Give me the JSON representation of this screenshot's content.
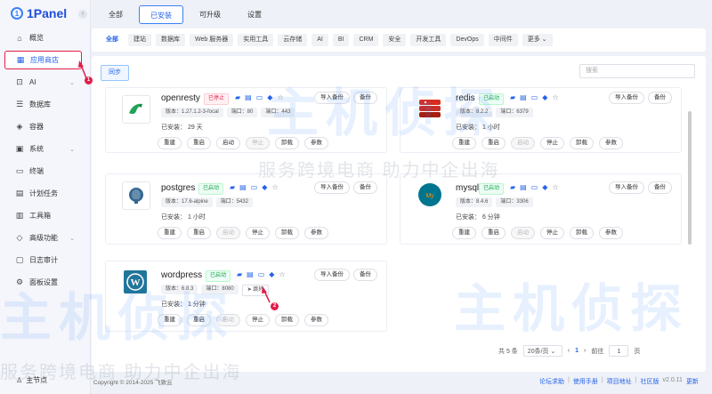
{
  "logo": {
    "text": "1Panel",
    "mark": "1"
  },
  "sidebar": {
    "items": [
      {
        "label": "概览",
        "icon": "home-icon"
      },
      {
        "label": "应用商店",
        "icon": "grid-icon",
        "active": true
      },
      {
        "label": "AI",
        "icon": "robot-icon",
        "expandable": true
      },
      {
        "label": "数据库",
        "icon": "database-icon"
      },
      {
        "label": "容器",
        "icon": "container-icon"
      },
      {
        "label": "系统",
        "icon": "system-icon",
        "expandable": true
      },
      {
        "label": "终端",
        "icon": "terminal-icon"
      },
      {
        "label": "计划任务",
        "icon": "task-icon"
      },
      {
        "label": "工具箱",
        "icon": "toolbox-icon"
      },
      {
        "label": "高级功能",
        "icon": "diamond-icon",
        "expandable": true
      },
      {
        "label": "日志审计",
        "icon": "log-icon"
      },
      {
        "label": "面板设置",
        "icon": "gear-icon"
      }
    ],
    "bottom_label": "主节点"
  },
  "tabs": [
    "全部",
    "已安装",
    "可升级",
    "设置"
  ],
  "active_tab": "已安装",
  "tags": [
    "全部",
    "建站",
    "数据库",
    "Web 服务器",
    "实用工具",
    "云存储",
    "AI",
    "BI",
    "CRM",
    "安全",
    "开发工具",
    "DevOps",
    "中间件",
    "更多"
  ],
  "sync_label": "同步",
  "search_placeholder": "搜索",
  "apps": [
    {
      "name": "openresty",
      "status": "已停止",
      "version": "版本：1.27.1.2-3-focal",
      "ports": [
        "端口：80",
        "端口：443"
      ],
      "installed": "已安装：  29 天",
      "disabled": [
        "停止"
      ]
    },
    {
      "name": "redis",
      "status": "已启动",
      "version": "版本：8.2.2",
      "ports": [
        "端口：6379"
      ],
      "installed": "已安装：  1 小时",
      "disabled": [
        "启动"
      ]
    },
    {
      "name": "postgres",
      "status": "已启动",
      "version": "版本：17.6-alpine",
      "ports": [
        "端口：5432"
      ],
      "installed": "已安装：  1 小时",
      "disabled": [
        "启动"
      ]
    },
    {
      "name": "mysql",
      "status": "已启动",
      "version": "版本：8.4.6",
      "ports": [
        "端口：3306"
      ],
      "installed": "已安装：  6 分钟",
      "disabled": [
        "启动"
      ]
    },
    {
      "name": "wordpress",
      "status": "已启动",
      "version": "版本：6.8.3",
      "ports": [
        "端口：8080"
      ],
      "jump": "跳转",
      "installed": "已安装：  1 分钟",
      "disabled": [
        "启动"
      ]
    }
  ],
  "app_right_buttons": [
    "导入备份",
    "备份"
  ],
  "app_actions": [
    "重建",
    "重启",
    "启动",
    "停止",
    "卸载",
    "参数"
  ],
  "pagination": {
    "total": "共 5 条",
    "page_size": "20条/页",
    "current": "1",
    "goto_label": "前往",
    "goto_value": "1",
    "page_suffix": "页"
  },
  "footer": {
    "copyright": "Copyright © 2014-2025 飞致云",
    "links": [
      "论坛求助",
      "使用手册",
      "项目地址",
      "社区版"
    ],
    "version": "v2.0.11",
    "update": "更新"
  },
  "callouts": [
    "1",
    "2"
  ],
  "watermark": {
    "line": "服务跨境电商 助力中企出海",
    "logo": "主机侦探"
  },
  "colors": {
    "accent": "#2563eb",
    "running": "#16a34a",
    "stopped": "#e11d48"
  }
}
